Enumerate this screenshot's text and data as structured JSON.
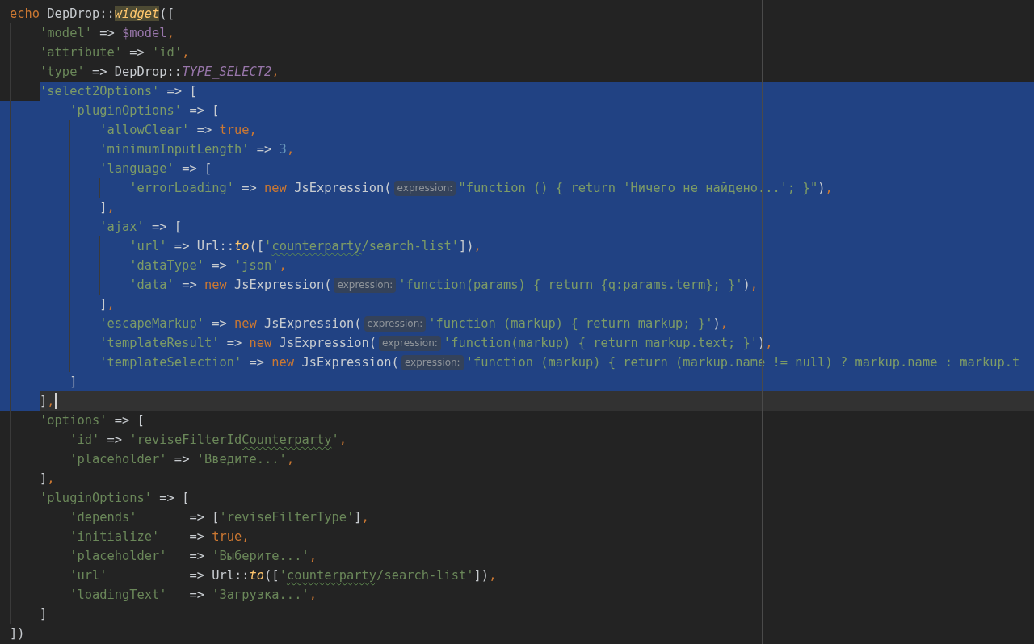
{
  "code": [
    {
      "text_selected": false,
      "indent_selected": false,
      "current": false,
      "tokens": [
        {
          "kind": "keyword",
          "text": "echo"
        },
        {
          "kind": "plain",
          "text": " DepDrop::"
        },
        {
          "kind": "method",
          "text": "widget",
          "highlighted": true
        },
        {
          "kind": "plain",
          "text": "(["
        }
      ],
      "children": [
        {
          "text_selected": false,
          "indent_selected": false,
          "current": false,
          "tokens": [
            {
              "kind": "string",
              "text": "'model'"
            },
            {
              "kind": "plain",
              "text": " => "
            },
            {
              "kind": "variable",
              "text": "$model"
            },
            {
              "kind": "comma",
              "text": ","
            }
          ]
        },
        {
          "text_selected": false,
          "indent_selected": false,
          "current": false,
          "tokens": [
            {
              "kind": "string",
              "text": "'attribute'"
            },
            {
              "kind": "plain",
              "text": " => "
            },
            {
              "kind": "string",
              "text": "'id'"
            },
            {
              "kind": "comma",
              "text": ","
            }
          ]
        },
        {
          "text_selected": false,
          "indent_selected": false,
          "current": false,
          "tokens": [
            {
              "kind": "string",
              "text": "'type'"
            },
            {
              "kind": "plain",
              "text": " => DepDrop::"
            },
            {
              "kind": "constant",
              "text": "TYPE_SELECT2"
            },
            {
              "kind": "comma",
              "text": ","
            }
          ]
        },
        {
          "text_selected": true,
          "indent_selected": false,
          "current": false,
          "tokens": [
            {
              "kind": "string",
              "text": "'select2Options'"
            },
            {
              "kind": "plain",
              "text": " => ["
            }
          ],
          "children": [
            {
              "text_selected": true,
              "indent_selected": true,
              "current": false,
              "tokens": [
                {
                  "kind": "string",
                  "text": "'pluginOptions'"
                },
                {
                  "kind": "plain",
                  "text": " => ["
                }
              ],
              "children": [
                {
                  "text_selected": true,
                  "indent_selected": true,
                  "current": false,
                  "tokens": [
                    {
                      "kind": "string",
                      "text": "'allowClear'"
                    },
                    {
                      "kind": "plain",
                      "text": " => "
                    },
                    {
                      "kind": "keyword",
                      "text": "true"
                    },
                    {
                      "kind": "comma",
                      "text": ","
                    }
                  ]
                },
                {
                  "text_selected": true,
                  "indent_selected": true,
                  "current": false,
                  "tokens": [
                    {
                      "kind": "string",
                      "text": "'minimumInputLength'"
                    },
                    {
                      "kind": "plain",
                      "text": " => "
                    },
                    {
                      "kind": "number",
                      "text": "3"
                    },
                    {
                      "kind": "comma",
                      "text": ","
                    }
                  ]
                },
                {
                  "text_selected": true,
                  "indent_selected": true,
                  "current": false,
                  "tokens": [
                    {
                      "kind": "string",
                      "text": "'language'"
                    },
                    {
                      "kind": "plain",
                      "text": " => ["
                    }
                  ],
                  "children": [
                    {
                      "text_selected": true,
                      "indent_selected": true,
                      "current": false,
                      "tokens": [
                        {
                          "kind": "string",
                          "text": "'errorLoading'"
                        },
                        {
                          "kind": "plain",
                          "text": " => "
                        },
                        {
                          "kind": "keyword",
                          "text": "new"
                        },
                        {
                          "kind": "plain",
                          "text": " JsExpression("
                        },
                        {
                          "kind": "hint",
                          "text": "expression:"
                        },
                        {
                          "kind": "string",
                          "text": "\"function () { return 'Ничего не найдено...'; }\""
                        },
                        {
                          "kind": "plain",
                          "text": ")"
                        },
                        {
                          "kind": "comma",
                          "text": ","
                        }
                      ]
                    }
                  ]
                },
                {
                  "text_selected": true,
                  "indent_selected": true,
                  "current": false,
                  "tokens": [
                    {
                      "kind": "plain",
                      "text": "]"
                    },
                    {
                      "kind": "comma",
                      "text": ","
                    }
                  ]
                },
                {
                  "text_selected": true,
                  "indent_selected": true,
                  "current": false,
                  "tokens": [
                    {
                      "kind": "string",
                      "text": "'ajax'"
                    },
                    {
                      "kind": "plain",
                      "text": " => ["
                    }
                  ],
                  "children": [
                    {
                      "text_selected": true,
                      "indent_selected": true,
                      "current": false,
                      "tokens": [
                        {
                          "kind": "string",
                          "text": "'url'"
                        },
                        {
                          "kind": "plain",
                          "text": " => Url::"
                        },
                        {
                          "kind": "method",
                          "text": "to"
                        },
                        {
                          "kind": "plain",
                          "text": "(["
                        },
                        {
                          "kind": "string",
                          "text": "'"
                        },
                        {
                          "kind": "string",
                          "text": "counterparty",
                          "misspelled": true
                        },
                        {
                          "kind": "string",
                          "text": "/search-list'"
                        },
                        {
                          "kind": "plain",
                          "text": "])"
                        },
                        {
                          "kind": "comma",
                          "text": ","
                        }
                      ]
                    },
                    {
                      "text_selected": true,
                      "indent_selected": true,
                      "current": false,
                      "tokens": [
                        {
                          "kind": "string",
                          "text": "'dataType'"
                        },
                        {
                          "kind": "plain",
                          "text": " => "
                        },
                        {
                          "kind": "string",
                          "text": "'json'"
                        },
                        {
                          "kind": "comma",
                          "text": ","
                        }
                      ]
                    },
                    {
                      "text_selected": true,
                      "indent_selected": true,
                      "current": false,
                      "tokens": [
                        {
                          "kind": "string",
                          "text": "'data'"
                        },
                        {
                          "kind": "plain",
                          "text": " => "
                        },
                        {
                          "kind": "keyword",
                          "text": "new"
                        },
                        {
                          "kind": "plain",
                          "text": " JsExpression("
                        },
                        {
                          "kind": "hint",
                          "text": "expression:"
                        },
                        {
                          "kind": "string",
                          "text": "'function(params) { return {q:params.term}; }'"
                        },
                        {
                          "kind": "plain",
                          "text": ")"
                        },
                        {
                          "kind": "comma",
                          "text": ","
                        }
                      ]
                    }
                  ]
                },
                {
                  "text_selected": true,
                  "indent_selected": true,
                  "current": false,
                  "tokens": [
                    {
                      "kind": "plain",
                      "text": "]"
                    },
                    {
                      "kind": "comma",
                      "text": ","
                    }
                  ]
                },
                {
                  "text_selected": true,
                  "indent_selected": true,
                  "current": false,
                  "tokens": [
                    {
                      "kind": "string",
                      "text": "'escapeMarkup'"
                    },
                    {
                      "kind": "plain",
                      "text": " => "
                    },
                    {
                      "kind": "keyword",
                      "text": "new"
                    },
                    {
                      "kind": "plain",
                      "text": " JsExpression("
                    },
                    {
                      "kind": "hint",
                      "text": "expression:"
                    },
                    {
                      "kind": "string",
                      "text": "'function (markup) { return markup; }'"
                    },
                    {
                      "kind": "plain",
                      "text": ")"
                    },
                    {
                      "kind": "comma",
                      "text": ","
                    }
                  ]
                },
                {
                  "text_selected": true,
                  "indent_selected": true,
                  "current": false,
                  "tokens": [
                    {
                      "kind": "string",
                      "text": "'templateResult'"
                    },
                    {
                      "kind": "plain",
                      "text": " => "
                    },
                    {
                      "kind": "keyword",
                      "text": "new"
                    },
                    {
                      "kind": "plain",
                      "text": " JsExpression("
                    },
                    {
                      "kind": "hint",
                      "text": "expression:"
                    },
                    {
                      "kind": "string",
                      "text": "'function(markup) { return markup.text; }'"
                    },
                    {
                      "kind": "plain",
                      "text": ")"
                    },
                    {
                      "kind": "comma",
                      "text": ","
                    }
                  ]
                },
                {
                  "text_selected": true,
                  "indent_selected": true,
                  "current": false,
                  "tokens": [
                    {
                      "kind": "string",
                      "text": "'templateSelection'"
                    },
                    {
                      "kind": "plain",
                      "text": " => "
                    },
                    {
                      "kind": "keyword",
                      "text": "new"
                    },
                    {
                      "kind": "plain",
                      "text": " JsExpression("
                    },
                    {
                      "kind": "hint",
                      "text": "expression:"
                    },
                    {
                      "kind": "string",
                      "text": "'function (markup) { return (markup.name != null) ? markup.name : markup.t"
                    }
                  ]
                }
              ]
            },
            {
              "text_selected": true,
              "indent_selected": true,
              "current": false,
              "tokens": [
                {
                  "kind": "plain",
                  "text": "]"
                }
              ]
            }
          ]
        },
        {
          "text_selected": false,
          "indent_selected": true,
          "current": true,
          "tokens": [
            {
              "kind": "plain",
              "text": "]"
            },
            {
              "kind": "comma",
              "text": ","
            }
          ]
        },
        {
          "text_selected": false,
          "indent_selected": false,
          "current": false,
          "tokens": [
            {
              "kind": "string",
              "text": "'options'"
            },
            {
              "kind": "plain",
              "text": " => ["
            }
          ],
          "children": [
            {
              "text_selected": false,
              "indent_selected": false,
              "current": false,
              "tokens": [
                {
                  "kind": "string",
                  "text": "'id'"
                },
                {
                  "kind": "plain",
                  "text": " => "
                },
                {
                  "kind": "string",
                  "text": "'reviseFilterId"
                },
                {
                  "kind": "string",
                  "text": "Counterparty",
                  "misspelled": true
                },
                {
                  "kind": "string",
                  "text": "'"
                },
                {
                  "kind": "comma",
                  "text": ","
                }
              ]
            },
            {
              "text_selected": false,
              "indent_selected": false,
              "current": false,
              "tokens": [
                {
                  "kind": "string",
                  "text": "'placeholder'"
                },
                {
                  "kind": "plain",
                  "text": " => "
                },
                {
                  "kind": "string",
                  "text": "'Введите...'"
                },
                {
                  "kind": "comma",
                  "text": ","
                }
              ]
            }
          ]
        },
        {
          "text_selected": false,
          "indent_selected": false,
          "current": false,
          "tokens": [
            {
              "kind": "plain",
              "text": "]"
            },
            {
              "kind": "comma",
              "text": ","
            }
          ]
        },
        {
          "text_selected": false,
          "indent_selected": false,
          "current": false,
          "tokens": [
            {
              "kind": "string",
              "text": "'pluginOptions'"
            },
            {
              "kind": "plain",
              "text": " => ["
            }
          ],
          "children": [
            {
              "text_selected": false,
              "indent_selected": false,
              "current": false,
              "tokens": [
                {
                  "kind": "string",
                  "text": "'depends'"
                },
                {
                  "kind": "plain",
                  "text": "       => ["
                },
                {
                  "kind": "string",
                  "text": "'reviseFilterType'"
                },
                {
                  "kind": "plain",
                  "text": "]"
                },
                {
                  "kind": "comma",
                  "text": ","
                }
              ]
            },
            {
              "text_selected": false,
              "indent_selected": false,
              "current": false,
              "tokens": [
                {
                  "kind": "string",
                  "text": "'initialize'"
                },
                {
                  "kind": "plain",
                  "text": "    => "
                },
                {
                  "kind": "keyword",
                  "text": "true"
                },
                {
                  "kind": "comma",
                  "text": ","
                }
              ]
            },
            {
              "text_selected": false,
              "indent_selected": false,
              "current": false,
              "tokens": [
                {
                  "kind": "string",
                  "text": "'placeholder'"
                },
                {
                  "kind": "plain",
                  "text": "   => "
                },
                {
                  "kind": "string",
                  "text": "'Выберите...'"
                },
                {
                  "kind": "comma",
                  "text": ","
                }
              ]
            },
            {
              "text_selected": false,
              "indent_selected": false,
              "current": false,
              "tokens": [
                {
                  "kind": "string",
                  "text": "'url'"
                },
                {
                  "kind": "plain",
                  "text": "           => Url::"
                },
                {
                  "kind": "method",
                  "text": "to"
                },
                {
                  "kind": "plain",
                  "text": "(["
                },
                {
                  "kind": "string",
                  "text": "'"
                },
                {
                  "kind": "string",
                  "text": "counterparty",
                  "misspelled": true
                },
                {
                  "kind": "string",
                  "text": "/search-list'"
                },
                {
                  "kind": "plain",
                  "text": "])"
                },
                {
                  "kind": "comma",
                  "text": ","
                }
              ]
            },
            {
              "text_selected": false,
              "indent_selected": false,
              "current": false,
              "tokens": [
                {
                  "kind": "string",
                  "text": "'loadingText'"
                },
                {
                  "kind": "plain",
                  "text": "   => "
                },
                {
                  "kind": "string",
                  "text": "'Загрузка...'"
                },
                {
                  "kind": "comma",
                  "text": ","
                }
              ]
            }
          ]
        },
        {
          "text_selected": false,
          "indent_selected": false,
          "current": false,
          "tokens": [
            {
              "kind": "plain",
              "text": "]"
            }
          ]
        }
      ]
    },
    {
      "text_selected": false,
      "indent_selected": false,
      "current": false,
      "tokens": [
        {
          "kind": "plain",
          "text": "])"
        }
      ]
    }
  ]
}
